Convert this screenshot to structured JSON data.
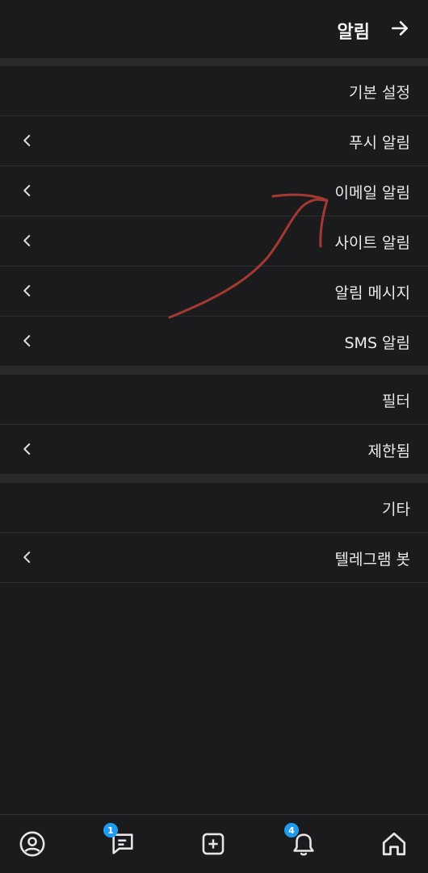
{
  "header": {
    "title": "알림",
    "back_icon": "arrow-right-icon"
  },
  "sections": [
    {
      "header": "기본 설정",
      "items": [
        {
          "label": "푸시 알림"
        },
        {
          "label": "이메일 알림"
        },
        {
          "label": "사이트 알림"
        },
        {
          "label": "알림 메시지"
        },
        {
          "label": "SMS 알림"
        }
      ]
    },
    {
      "header": "필터",
      "items": [
        {
          "label": "제한됨"
        }
      ]
    },
    {
      "header": "기타",
      "items": [
        {
          "label": "텔레그램 봇"
        }
      ]
    }
  ],
  "bottom_nav": {
    "items": [
      {
        "icon": "profile-icon"
      },
      {
        "icon": "messages-icon",
        "badge": "1"
      },
      {
        "icon": "add-icon"
      },
      {
        "icon": "bell-icon",
        "badge": "4"
      },
      {
        "icon": "home-icon"
      }
    ]
  },
  "colors": {
    "background": "#1b1b1d",
    "separator": "#2a2a2d",
    "badge": "#1d9bf0",
    "annotation": "#a33a32"
  }
}
